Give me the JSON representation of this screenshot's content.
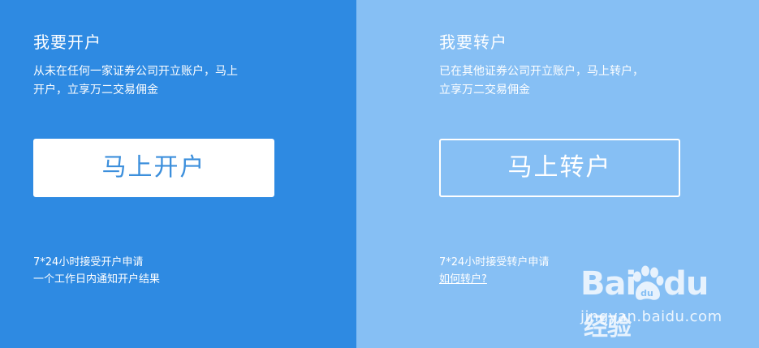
{
  "open_account": {
    "title": "我要开户",
    "desc_line1": "从未在任何一家证券公司开立账户，马上",
    "desc_line2": "开户，立享万二交易佣金",
    "button_label": "马上开户",
    "note_line1": "7*24小时接受开户申请",
    "note_line2": "一个工作日内通知开户结果"
  },
  "transfer_account": {
    "title": "我要转户",
    "desc_line1": "已在其他证券公司开立账户，马上转户，",
    "desc_line2": "立享万二交易佣金",
    "button_label": "马上转户",
    "note_line1": "7*24小时接受转户申请",
    "help_link": "如何转户?"
  },
  "watermark": {
    "logo_text": "Bai du 经验",
    "logo_part1": "Bai",
    "logo_part2": "du",
    "logo_part3": "经验",
    "url": "jingyan.baidu.com"
  },
  "colors": {
    "left_panel_bg": "#2e8ae2",
    "right_panel_bg": "#86bff4",
    "open_button_text": "#3c8fdc",
    "white": "#ffffff"
  },
  "icons": {
    "watermark_paw": "baidu-paw-icon"
  }
}
